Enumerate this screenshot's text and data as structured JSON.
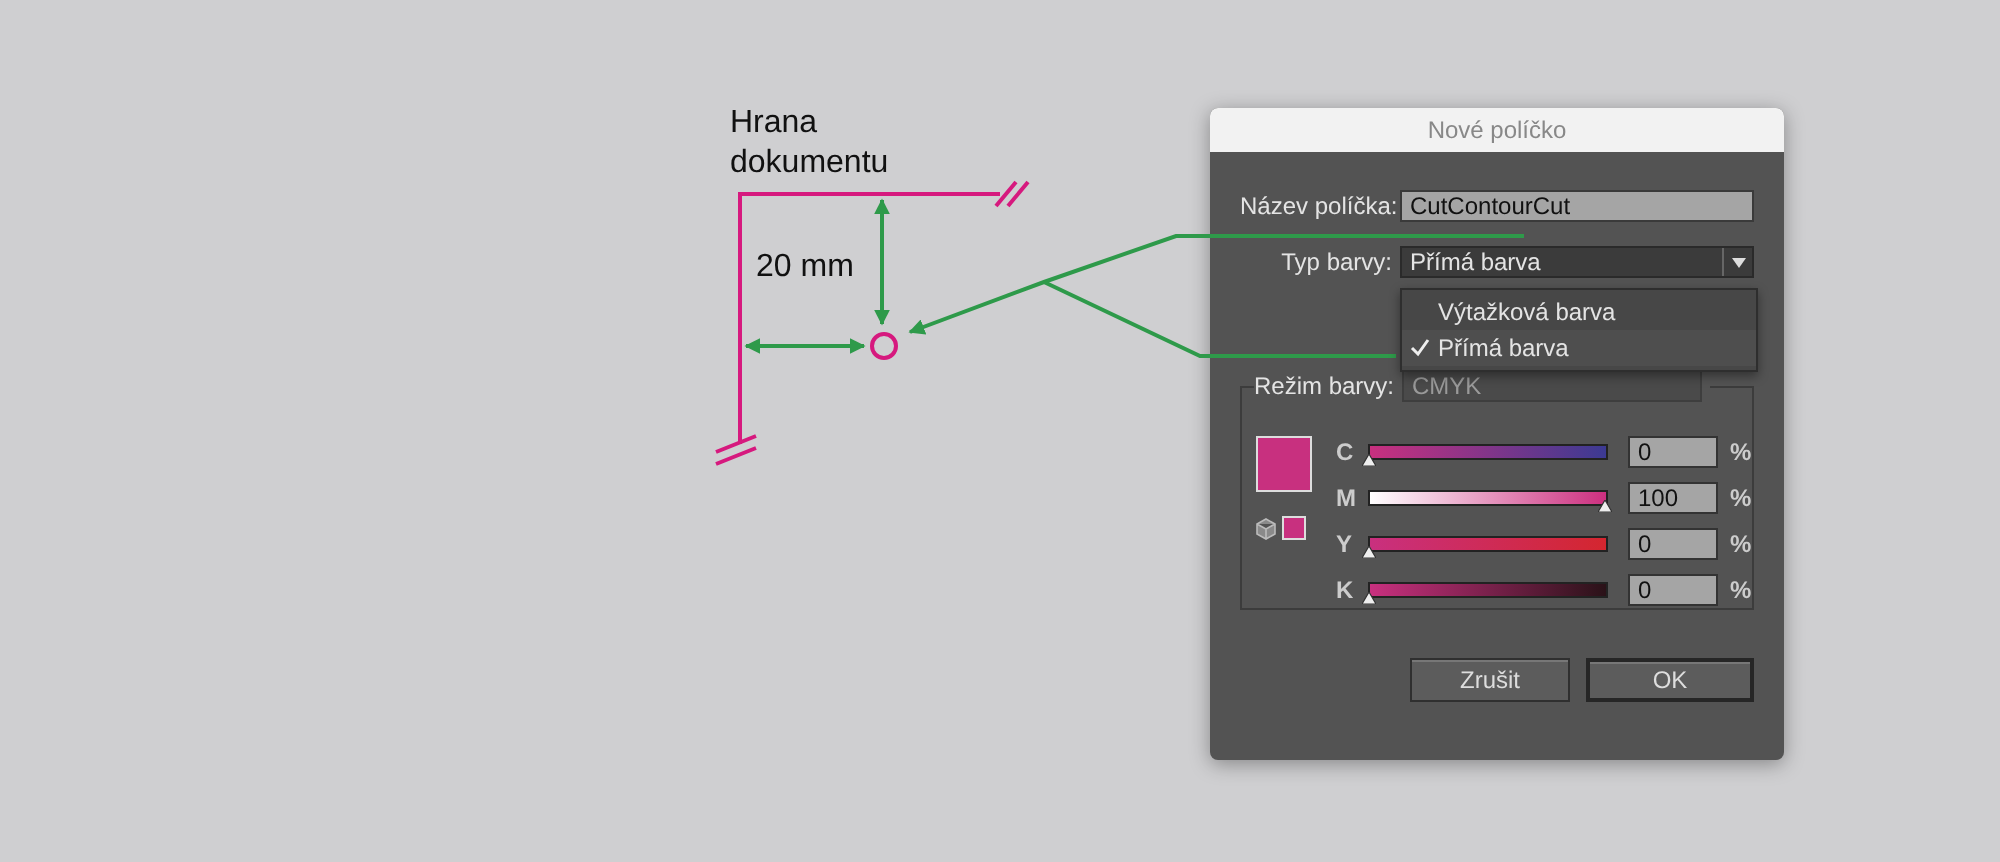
{
  "diagram": {
    "edge_label": "Hrana dokumentu",
    "distance_label": "20 mm"
  },
  "dialog": {
    "title": "Nové políčko",
    "name_label": "Název políčka:",
    "name_value": "CutContourCut",
    "type_label": "Typ barvy:",
    "type_value": "Přímá barva",
    "type_menu": [
      {
        "label": "Výtažková barva",
        "selected": false
      },
      {
        "label": "Přímá barva",
        "selected": true
      }
    ],
    "mode_label": "Režim barvy:",
    "mode_value": "CMYK",
    "channels": [
      {
        "label": "C",
        "level": 0,
        "value": "0",
        "unit": "%"
      },
      {
        "label": "M",
        "level": 1,
        "value": "100",
        "unit": "%"
      },
      {
        "label": "Y",
        "level": 0,
        "value": "0",
        "unit": "%"
      },
      {
        "label": "K",
        "level": 0,
        "value": "0",
        "unit": "%"
      }
    ],
    "buttons": [
      {
        "label": "Zrušit",
        "default": false
      },
      {
        "label": "OK",
        "default": true
      }
    ]
  }
}
